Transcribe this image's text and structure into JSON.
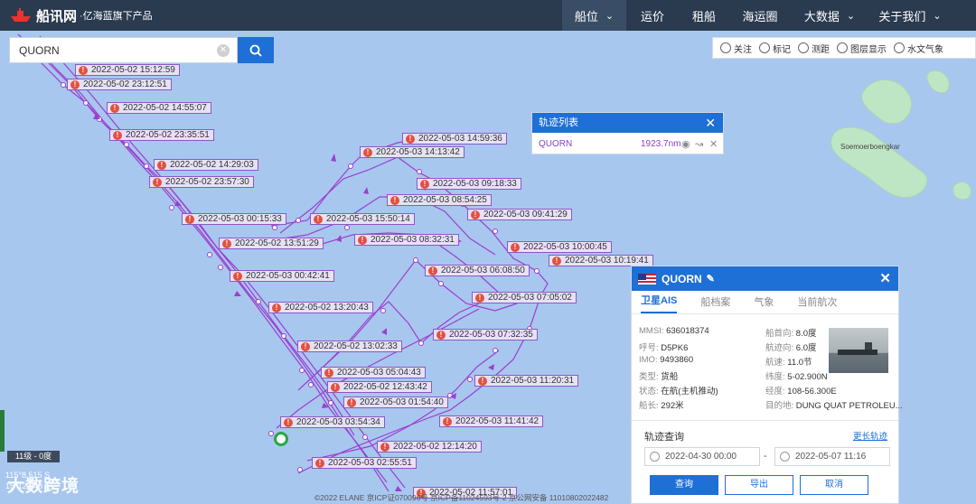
{
  "brand": {
    "name": "船讯网",
    "tagline": "·亿海蓝旗下产品"
  },
  "nav": [
    {
      "label": "船位",
      "caret": true,
      "active": true
    },
    {
      "label": "运价",
      "caret": false
    },
    {
      "label": "租船",
      "caret": false
    },
    {
      "label": "海运圈",
      "caret": false
    },
    {
      "label": "大数据",
      "caret": true
    },
    {
      "label": "关于我们",
      "caret": true
    }
  ],
  "search": {
    "value": "QUORN",
    "placeholder": ""
  },
  "toolbar": [
    "关注",
    "标记",
    "测距",
    "图层显示",
    "水文气象"
  ],
  "map": {
    "island_label": "Soemoerboengkar",
    "track_color": "#9b3fd1",
    "labels": [
      "2022-05-02 15:12:59",
      "2022-05-02 23:12:51",
      "2022-05-02 14:55:07",
      "2022-05-02 23:35:51",
      "2022-05-02 14:29:03",
      "2022-05-02 23:57:30",
      "2022-05-03 00:15:33",
      "2022-05-02 13:51:29",
      "2022-05-03 00:42:41",
      "2022-05-02 13:20:43",
      "2022-05-02 13:02:33",
      "2022-05-03 05:04:43",
      "2022-05-02 12:43:42",
      "2022-05-03 01:54:40",
      "2022-05-03 03:54:34",
      "2022-05-02 12:14:20",
      "2022-05-03 02:55:51",
      "2022-05-02 11:57:01",
      "2022-05-03 14:59:36",
      "2022-05-03 14:13:42",
      "2022-05-03 09:18:33",
      "2022-05-03 08:54:25",
      "2022-05-03 09:41:29",
      "2022-05-03 15:50:14",
      "2022-05-03 08:32:31",
      "2022-05-03 10:00:45",
      "2022-05-03 10:19:41",
      "2022-05-03 06:08:50",
      "2022-05-03 07:05:02",
      "2022-05-03 07:32:35",
      "2022-05-03 11:20:31",
      "2022-05-03 11:41:42"
    ]
  },
  "track_list": {
    "title": "轨迹列表",
    "rows": [
      {
        "name": "QUORN",
        "distance": "1923.7nm"
      }
    ]
  },
  "ship_panel": {
    "name": "QUORN",
    "tabs": [
      "卫星AIS",
      "船档案",
      "气象",
      "当前航次"
    ],
    "info_left": [
      {
        "key": "MMSI:",
        "value": "636018374"
      },
      {
        "key": "呼号:",
        "value": "D5PK6"
      },
      {
        "key": "IMO:",
        "value": "9493860"
      },
      {
        "key": "类型:",
        "value": "货船"
      },
      {
        "key": "状态:",
        "value": "在航(主机推动)"
      },
      {
        "key": "船长:",
        "value": "292米"
      }
    ],
    "info_right": [
      {
        "key": "船首向:",
        "value": "8.0度"
      },
      {
        "key": "航迹向:",
        "value": "6.0度"
      },
      {
        "key": "航速:",
        "value": "11.0节"
      },
      {
        "key": "纬度:",
        "value": "5-02.900N"
      },
      {
        "key": "经度:",
        "value": "108-56.300E"
      },
      {
        "key": "目的地:",
        "value": "DUNG QUAT PETROLEU..."
      }
    ],
    "track_query": {
      "title": "轨迹查询",
      "more_link": "更长轨迹",
      "start": "2022-04-30 00:00",
      "end": "2022-05-07 11:16",
      "separator": "-",
      "buttons": [
        "查询",
        "导出",
        "取消"
      ]
    }
  },
  "status": {
    "zoom": "11级 - 0度",
    "coord1": "115°8.515 S",
    "coord2": "15°12.248 E",
    "watermark": "大数跨境",
    "copyright": "©2022 ELANE 京ICP证070096号 京ICP备11024593号-2 京公网安备 11010802022482"
  }
}
